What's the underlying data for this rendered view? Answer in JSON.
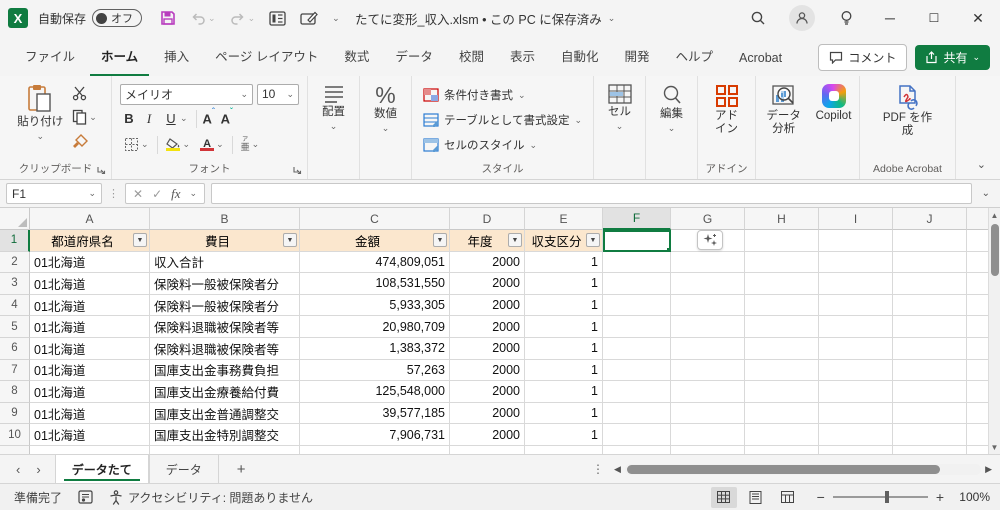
{
  "titlebar": {
    "autosave_label": "自動保存",
    "autosave_state": "オフ",
    "filename": "たてに変形_収入.xlsm • この PC に保存済み"
  },
  "ribbon_tabs": [
    {
      "label": "ファイル"
    },
    {
      "label": "ホーム",
      "active": true
    },
    {
      "label": "挿入"
    },
    {
      "label": "ページ レイアウト"
    },
    {
      "label": "数式"
    },
    {
      "label": "データ"
    },
    {
      "label": "校閲"
    },
    {
      "label": "表示"
    },
    {
      "label": "自動化"
    },
    {
      "label": "開発"
    },
    {
      "label": "ヘルプ"
    },
    {
      "label": "Acrobat"
    }
  ],
  "actions": {
    "comment": "コメント",
    "share": "共有"
  },
  "ribbon": {
    "paste": "貼り付け",
    "clipboard_group": "クリップボード",
    "font_name": "メイリオ",
    "font_size": "10",
    "font_group": "フォント",
    "alignment": "配置",
    "number": "数値",
    "conditional_format": "条件付き書式",
    "format_as_table": "テーブルとして書式設定",
    "cell_styles": "セルのスタイル",
    "styles_group": "スタイル",
    "cells": "セル",
    "editing": "編集",
    "addins": "アドイン",
    "addins_group": "アドイン",
    "data_analysis": "データ分析",
    "copilot": "Copilot",
    "create_pdf": "PDF を作成",
    "acrobat_group": "Adobe Acrobat"
  },
  "formula_bar": {
    "cell_reference": "F1",
    "formula_value": ""
  },
  "grid": {
    "columns": [
      {
        "label": "A"
      },
      {
        "label": "B"
      },
      {
        "label": "C"
      },
      {
        "label": "D"
      },
      {
        "label": "E"
      },
      {
        "label": "F",
        "selected": true
      },
      {
        "label": "G"
      },
      {
        "label": "H"
      },
      {
        "label": "I"
      },
      {
        "label": "J"
      }
    ],
    "header_row": {
      "row_number": "1",
      "prefecture": "都道府県名",
      "item": "費目",
      "amount": "金額",
      "year": "年度",
      "category": "収支区分"
    },
    "rows": [
      {
        "n": "2",
        "prefecture": "01北海道",
        "item": "収入合計",
        "amount": "474,809,051",
        "year": "2000",
        "category": "1"
      },
      {
        "n": "3",
        "prefecture": "01北海道",
        "item": "保険料一般被保険者分",
        "amount": "108,531,550",
        "year": "2000",
        "category": "1"
      },
      {
        "n": "4",
        "prefecture": "01北海道",
        "item": "保険料一般被保険者分",
        "amount": "5,933,305",
        "year": "2000",
        "category": "1"
      },
      {
        "n": "5",
        "prefecture": "01北海道",
        "item": "保険料退職被保険者等",
        "amount": "20,980,709",
        "year": "2000",
        "category": "1"
      },
      {
        "n": "6",
        "prefecture": "01北海道",
        "item": "保険料退職被保険者等",
        "amount": "1,383,372",
        "year": "2000",
        "category": "1"
      },
      {
        "n": "7",
        "prefecture": "01北海道",
        "item": "国庫支出金事務費負担",
        "amount": "57,263",
        "year": "2000",
        "category": "1"
      },
      {
        "n": "8",
        "prefecture": "01北海道",
        "item": "国庫支出金療養給付費",
        "amount": "125,548,000",
        "year": "2000",
        "category": "1"
      },
      {
        "n": "9",
        "prefecture": "01北海道",
        "item": "国庫支出金普通調整交",
        "amount": "39,577,185",
        "year": "2000",
        "category": "1"
      },
      {
        "n": "10",
        "prefecture": "01北海道",
        "item": "国庫支出金特別調整交",
        "amount": "7,906,731",
        "year": "2000",
        "category": "1"
      }
    ]
  },
  "sheet_tabs": [
    {
      "label": "データたて",
      "active": true
    },
    {
      "label": "データ"
    }
  ],
  "status_bar": {
    "mode": "準備完了",
    "accessibility": "アクセシビリティ: 問題ありません",
    "zoom_level": "100%"
  },
  "colors": {
    "accent_green": "#107C41",
    "table_header_fill": "#FBE7CE",
    "save_icon_purple": "#B83DBE"
  }
}
